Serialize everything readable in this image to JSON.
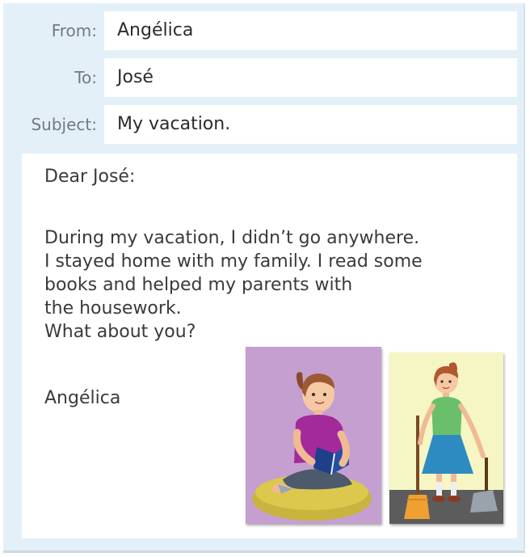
{
  "email": {
    "from_label": "From:",
    "from_value": "Angélica",
    "to_label": "To:",
    "to_value": "José",
    "subject_label": "Subject:",
    "subject_value": "My vacation."
  },
  "message": {
    "greeting": "Dear José:",
    "lines": [
      "During my vacation, I didn’t go anywhere.",
      "I stayed home with my family. I read some",
      "books and helped my parents with",
      "the housework.",
      "What about you?"
    ],
    "signature": "Angélica"
  },
  "illustrations": [
    "girl-reading-book-illustration",
    "girl-sweeping-illustration"
  ],
  "colors": {
    "panel_background": "#e4f0f8",
    "field_background": "#ffffff",
    "reading_scene_background": "#c59fcf",
    "sweeping_scene_background": "#f6f5c4"
  }
}
